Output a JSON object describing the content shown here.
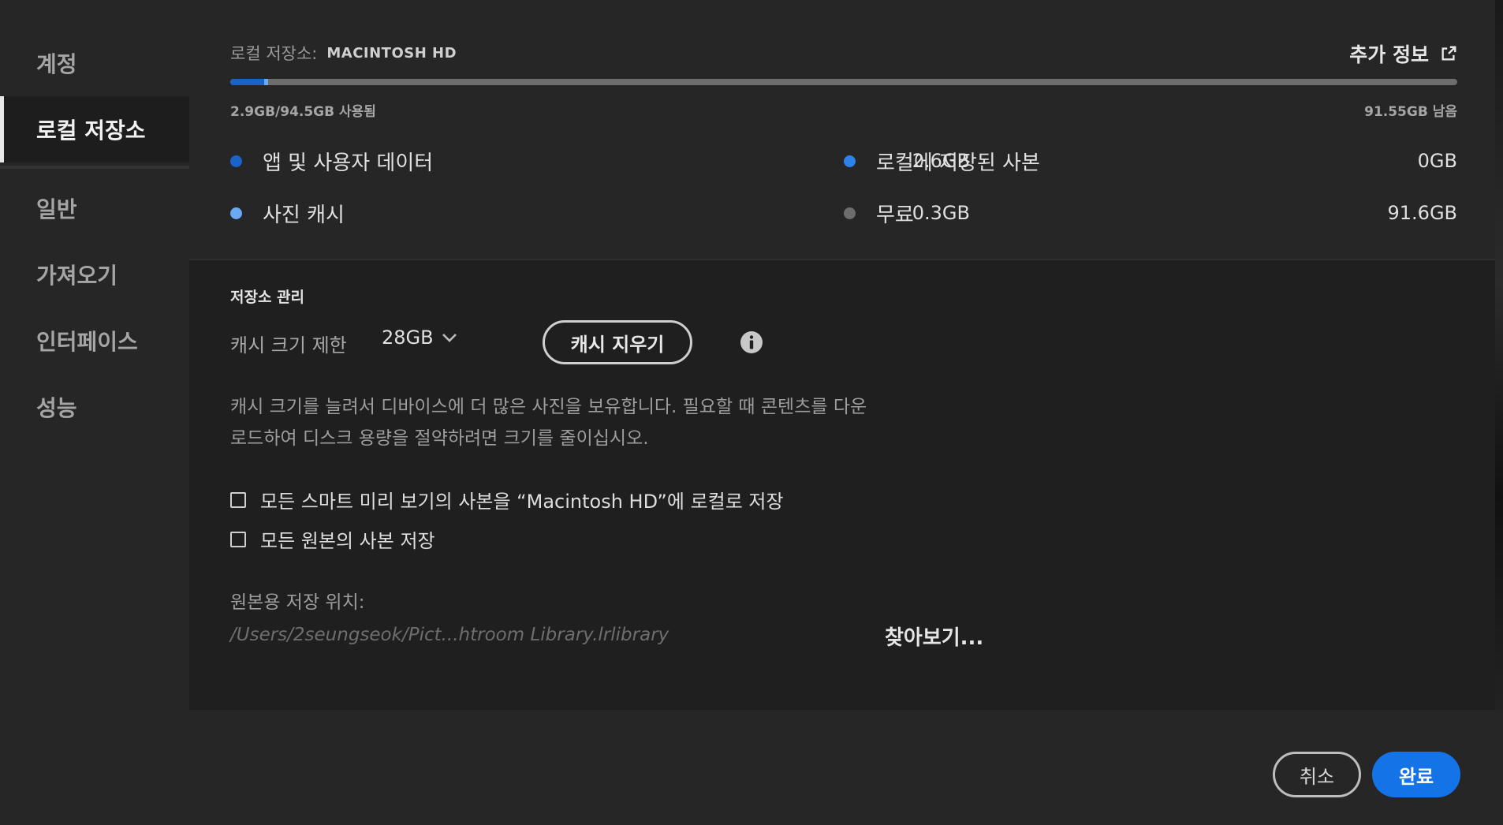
{
  "sidebar": {
    "items": [
      {
        "label": "계정",
        "active": false
      },
      {
        "label": "로컬 저장소",
        "active": true
      },
      {
        "label": "일반",
        "active": false
      },
      {
        "label": "가져오기",
        "active": false
      },
      {
        "label": "인터페이스",
        "active": false
      },
      {
        "label": "성능",
        "active": false
      }
    ]
  },
  "storage": {
    "label": "로컬 저장소:",
    "disk_name": "MACINTOSH HD",
    "more_info": "추가 정보",
    "used_summary": "2.9GB/94.5GB 사용됨",
    "remaining_summary": "91.55GB 남음",
    "usage": {
      "total_gb": 94.5,
      "app_data_gb": 2.6,
      "photo_cache_gb": 0.3
    },
    "legend": [
      {
        "label": "앱 및 사용자 데이터",
        "value": "2.6GB",
        "color": "#1a63c9"
      },
      {
        "label": "로컬에 저장된 사본",
        "value": "0GB",
        "color": "#2c82ea"
      },
      {
        "label": "사진 캐시",
        "value": "0.3GB",
        "color": "#6aa9f3"
      },
      {
        "label": "무료",
        "value": "91.6GB",
        "color": "#6d6d6d"
      }
    ]
  },
  "manage": {
    "title": "저장소 관리",
    "cache_limit_label": "캐시 크기 제한",
    "cache_limit_value": "28GB",
    "clear_cache_button": "캐시 지우기",
    "description_line1": "캐시 크기를 늘려서 디바이스에 더 많은 사진을 보유합니다. 필요할 때 콘텐츠를 다운",
    "description_line2": "로드하여 디스크 용량을 절약하려면 크기를 줄이십시오.",
    "checkbox_smart_previews": "모든 스마트 미리 보기의 사본을 “Macintosh HD”에 로컬로 저장",
    "checkbox_originals": "모든 원본의 사본 저장",
    "location_label": "원본용 저장 위치:",
    "location_path": "/Users/2seungseok/Pict...htroom Library.lrlibrary",
    "browse_button": "찾아보기..."
  },
  "footer": {
    "cancel": "취소",
    "done": "완료"
  }
}
